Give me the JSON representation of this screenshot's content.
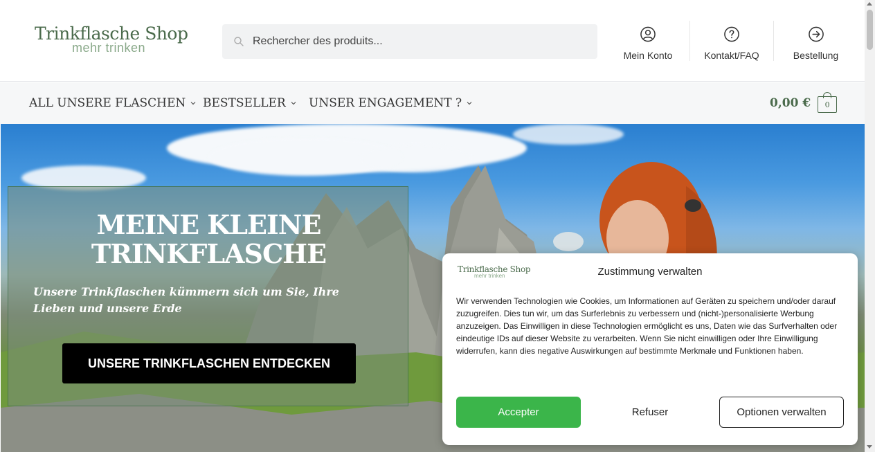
{
  "header": {
    "logo_main": "Trinkflasche Shop",
    "logo_sub": "mehr trinken",
    "search_placeholder": "Rechercher des produits...",
    "links": [
      {
        "label": "Mein Konto",
        "icon": "user-circle-icon"
      },
      {
        "label": "Kontakt/FAQ",
        "icon": "question-circle-icon"
      },
      {
        "label": "Bestellung",
        "icon": "arrow-circle-icon"
      }
    ]
  },
  "nav": {
    "items": [
      {
        "label": "ALL UNSERE FLASCHEN"
      },
      {
        "label": "BESTSELLER"
      },
      {
        "label": "UNSER ENGAGEMENT ?"
      }
    ],
    "cart_total": "0,00 €",
    "cart_count": "0"
  },
  "hero": {
    "title_line1": "MEINE KLEINE",
    "title_line2": "TRINKFLASCHE",
    "subtitle": "Unsere Trinkflaschen kümmern sich um Sie, Ihre Lieben und unsere Erde",
    "button": "UNSERE TRINKFLASCHEN ENTDECKEN"
  },
  "cookie": {
    "logo_main": "Trinkflasche Shop",
    "logo_sub": "mehr trinken",
    "title": "Zustimmung verwalten",
    "text": "Wir verwenden Technologien wie Cookies, um Informationen auf Geräten zu speichern und/oder darauf zuzugreifen. Dies tun wir, um das Surferlebnis zu verbessern und (nicht-)personalisierte Werbung anzuzeigen. Das Einwilligen in diese Technologien ermöglicht es uns, Daten wie das Surfverhalten oder eindeutige IDs auf dieser Website zu verarbeiten. Wenn Sie nicht einwilligen oder Ihre Einwilligung widerrufen, kann dies negative Auswirkungen auf bestimmte Merkmale und Funktionen haben.",
    "accept": "Accepter",
    "refuse": "Refuser",
    "options": "Optionen verwalten"
  },
  "colors": {
    "brand_green": "#4b6b4c",
    "accept_green": "#3bb54a"
  }
}
